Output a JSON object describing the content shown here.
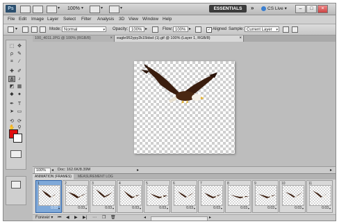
{
  "topbar": {
    "logo": "Ps",
    "zoom": "100%",
    "workspace": "ESSENTIALS",
    "chevron": "»",
    "cs_live": "CS Live",
    "win_min": "–",
    "win_max": "□",
    "win_close": "×"
  },
  "menu": [
    "File",
    "Edit",
    "Image",
    "Layer",
    "Select",
    "Filter",
    "Analysis",
    "3D",
    "View",
    "Window",
    "Help"
  ],
  "options": {
    "mode_label": "Mode:",
    "mode_value": "Normal",
    "opacity_label": "Opacity:",
    "opacity_value": "100%",
    "flow_label": "Flow:",
    "flow_value": "100%",
    "aligned_label": "Aligned",
    "sample_label": "Sample:",
    "sample_value": "Current Layer"
  },
  "doc_tabs": [
    {
      "label": "100_4011.JPG @ 100% (RGB/8)",
      "active": false
    },
    {
      "label": "eagle952ypy2k15ldsd (1).gif @ 100% (Layer 1, RGB/8)",
      "active": true
    }
  ],
  "status": {
    "zoom": "100%",
    "doc_info": "Doc: 162.6K/8.39M"
  },
  "anim_tabs": [
    "ANIMATION (FRAMES)",
    "MEASUREMENT LOG"
  ],
  "frames": [
    {
      "num": "1",
      "time": "0.03",
      "selected": true
    },
    {
      "num": "2",
      "time": "0.03",
      "selected": false
    },
    {
      "num": "3",
      "time": "0.03",
      "selected": false
    },
    {
      "num": "4",
      "time": "0.03",
      "selected": false
    },
    {
      "num": "5",
      "time": "0.03",
      "selected": false
    },
    {
      "num": "6",
      "time": "0.03",
      "selected": false
    },
    {
      "num": "7",
      "time": "0.03",
      "selected": false
    },
    {
      "num": "8",
      "time": "0.03",
      "selected": false
    },
    {
      "num": "9",
      "time": "0.03",
      "selected": false
    },
    {
      "num": "10",
      "time": "0.03",
      "selected": false
    },
    {
      "num": "11",
      "time": "0.03",
      "selected": false
    }
  ],
  "anim_controls": {
    "loop": "Forever"
  },
  "colors": {
    "foreground": "#e01010",
    "background": "#ffffff",
    "eagle_body": "#3a1d0e",
    "eagle_head": "#f4efe6",
    "eagle_beak": "#e5b22d"
  }
}
